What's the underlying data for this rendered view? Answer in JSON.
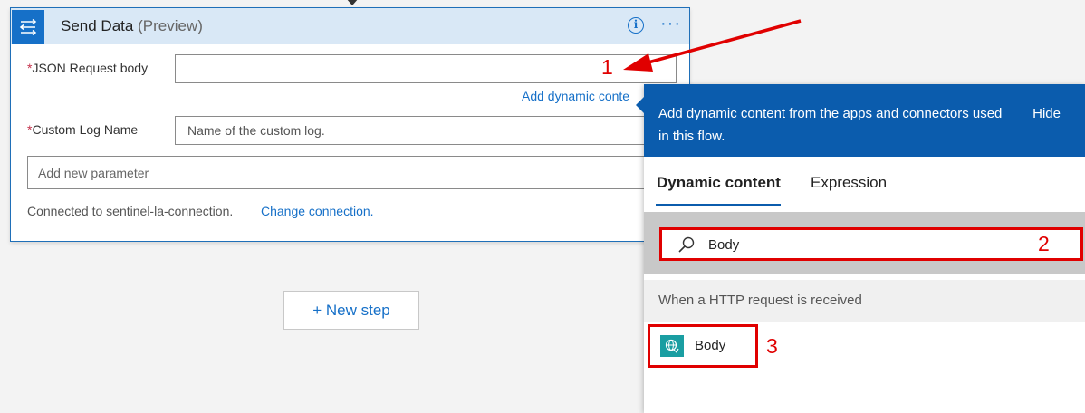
{
  "action_card": {
    "title": "Send Data",
    "title_suffix": "(Preview)",
    "fields": {
      "json_label": "JSON Request body",
      "json_value": "",
      "add_dynamic_link": "Add dynamic conte",
      "log_label": "Custom Log Name",
      "log_placeholder": "Name of the custom log.",
      "add_param_placeholder": "Add new parameter"
    },
    "connection_text": "Connected to sentinel-la-connection.",
    "change_connection": "Change connection."
  },
  "new_step_label": "+ New step",
  "dynamic_panel": {
    "header_text": "Add dynamic content from the apps and connectors used in this flow.",
    "hide_label": "Hide",
    "tabs": [
      {
        "label": "Dynamic content",
        "active": true
      },
      {
        "label": "Expression",
        "active": false
      }
    ],
    "search_value": "Body",
    "section_title": "When a HTTP request is received",
    "item_label": "Body"
  },
  "annotations": [
    "1",
    "2",
    "3"
  ],
  "colors": {
    "accent": "#1670c8",
    "panel_header": "#0b5cad",
    "annotation_red": "#e00000",
    "item_icon": "#1a9ea2"
  }
}
